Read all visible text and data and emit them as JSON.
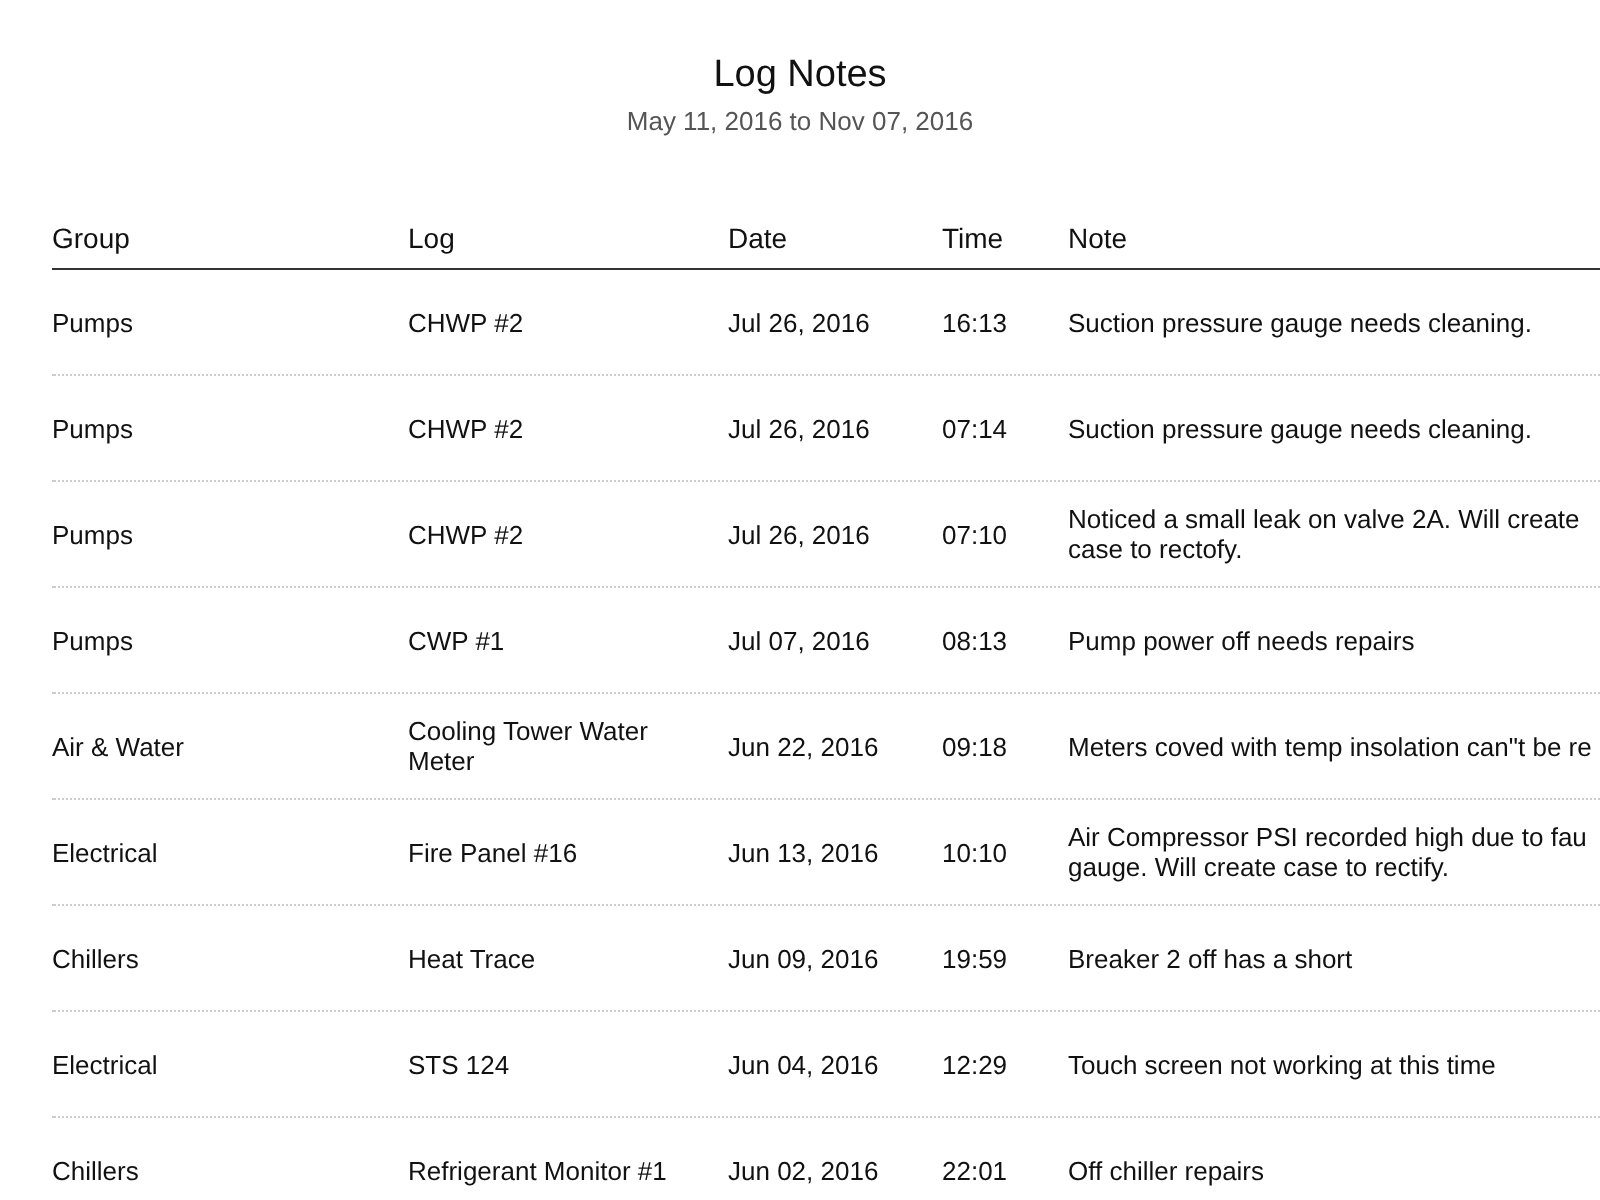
{
  "report": {
    "title": "Log Notes",
    "date_range": "May 11, 2016 to Nov 07, 2016"
  },
  "table": {
    "columns": [
      "Group",
      "Log",
      "Date",
      "Time",
      "Note"
    ],
    "rows": [
      {
        "group": "Pumps",
        "log": "CHWP #2",
        "date": "Jul 26, 2016",
        "time": "16:13",
        "note": "Suction pressure gauge needs cleaning."
      },
      {
        "group": "Pumps",
        "log": "CHWP #2",
        "date": "Jul 26, 2016",
        "time": "07:14",
        "note": "Suction pressure gauge needs cleaning."
      },
      {
        "group": "Pumps",
        "log": "CHWP #2",
        "date": "Jul 26, 2016",
        "time": "07:10",
        "note": "Noticed a small leak on valve 2A. Will create\ncase to rectofy."
      },
      {
        "group": "Pumps",
        "log": "CWP #1",
        "date": "Jul 07, 2016",
        "time": "08:13",
        "note": "Pump power off needs repairs"
      },
      {
        "group": "Air & Water",
        "log": "Cooling Tower Water\nMeter",
        "date": "Jun 22, 2016",
        "time": "09:18",
        "note": "Meters coved with temp insolation can\"t be re"
      },
      {
        "group": "Electrical",
        "log": "Fire Panel #16",
        "date": "Jun 13, 2016",
        "time": "10:10",
        "note": "Air Compressor PSI recorded high due to fau\ngauge. Will create case to rectify."
      },
      {
        "group": "Chillers",
        "log": "Heat Trace",
        "date": "Jun 09, 2016",
        "time": "19:59",
        "note": "Breaker 2 off has a short"
      },
      {
        "group": "Electrical",
        "log": "STS 124",
        "date": "Jun 04, 2016",
        "time": "12:29",
        "note": "Touch screen not working at this time"
      },
      {
        "group": "Chillers",
        "log": "Refrigerant Monitor #1",
        "date": "Jun 02, 2016",
        "time": "22:01",
        "note": "Off chiller repairs"
      }
    ]
  }
}
